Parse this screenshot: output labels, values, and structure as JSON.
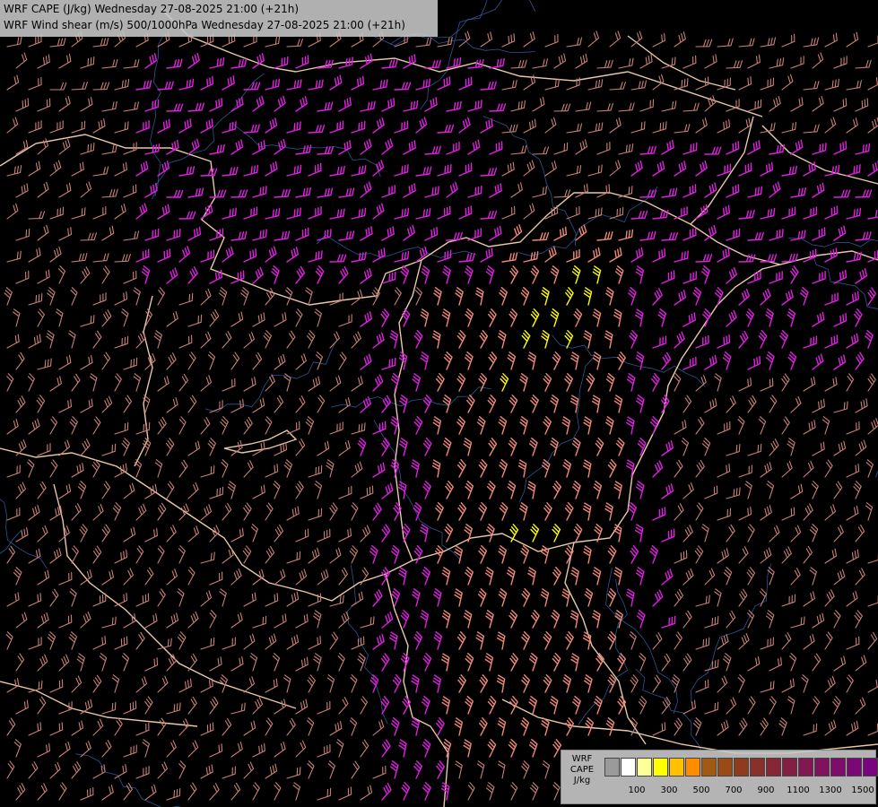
{
  "header": {
    "line1": "WRF CAPE (J/kg) Wednesday 27-08-2025 21:00 (+21h)",
    "line2": "WRF Wind shear (m/s) 500/1000hPa Wednesday 27-08-2025 21:00 (+21h)"
  },
  "legend": {
    "title_lines": [
      "WRF",
      "CAPE",
      "J/kg"
    ],
    "ticks": [
      "100",
      "300",
      "500",
      "700",
      "900",
      "1100",
      "1300",
      "1500"
    ],
    "colors": [
      "#ffffff",
      "#ffff9a",
      "#ffff00",
      "#ffc000",
      "#ff8c00",
      "#a05a14",
      "#9a4a14",
      "#8f3c1e",
      "#8a2f2a",
      "#862636",
      "#841f44",
      "#821852",
      "#80125e",
      "#7e0c6a",
      "#7c0876",
      "#7a0480"
    ]
  },
  "map": {
    "background": "#000000",
    "border_color": "#e8c8a8",
    "river_color": "#3a6ab8",
    "barb_colors": {
      "weak": "#c98078",
      "moderate": "#f08878",
      "strong": "#e020e0",
      "high_cape": "#ffff00"
    }
  }
}
